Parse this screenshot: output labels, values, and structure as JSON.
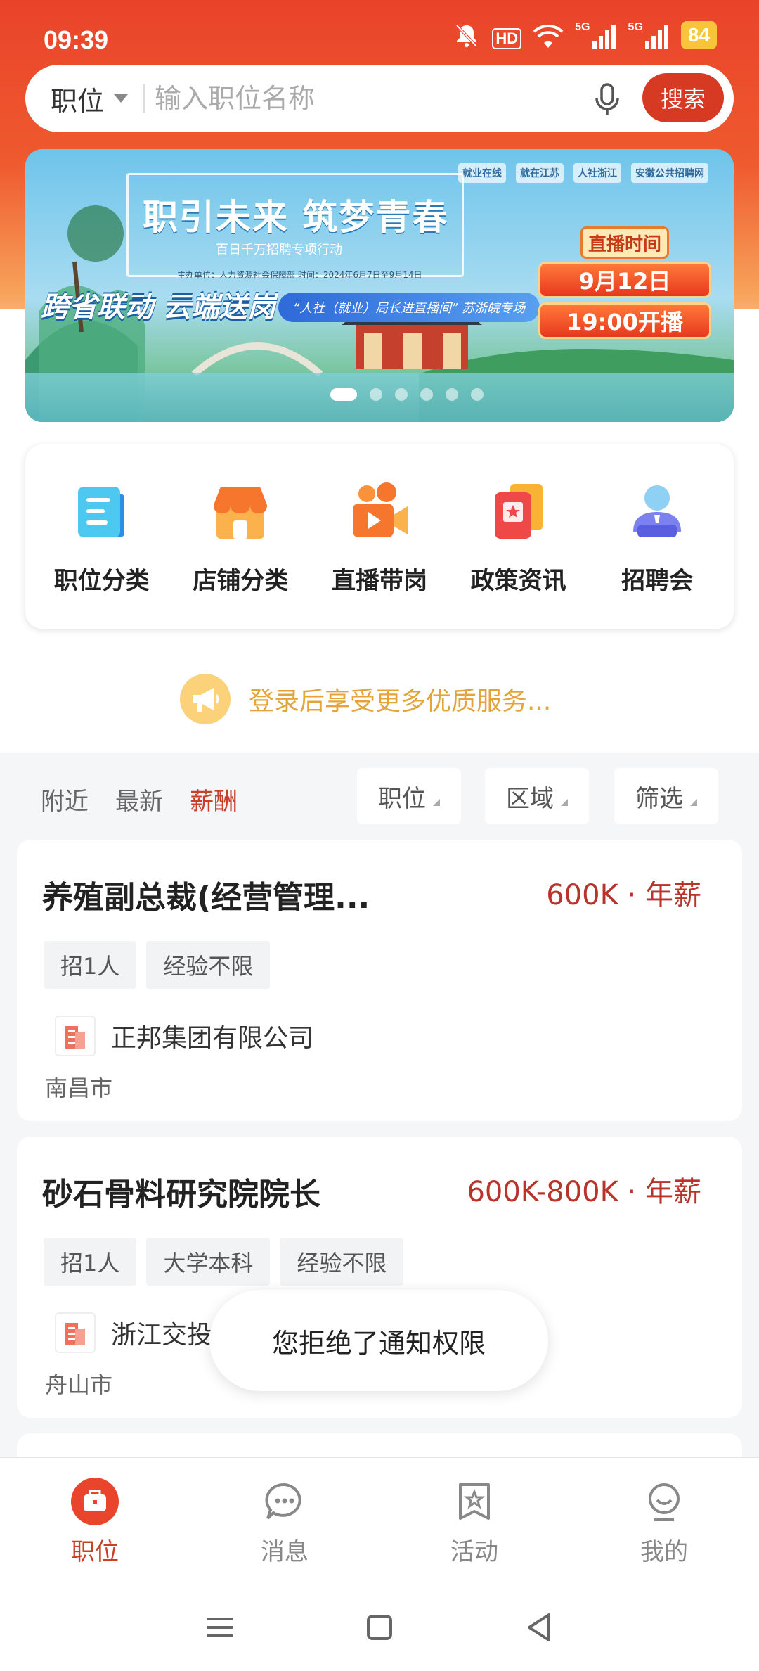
{
  "status_bar": {
    "time": "09:39",
    "hd_label": "HD",
    "signal1_label": "5G",
    "signal2_label": "5G",
    "battery": "84"
  },
  "search": {
    "category": "职位",
    "placeholder": "输入职位名称",
    "button_label": "搜索"
  },
  "banner": {
    "title": "职引未来  筑梦青春",
    "subtitle": "百日千万招聘专项行动",
    "org_line": "主办单位：人力资源社会保障部    时间：2024年6月7日至9月14日",
    "slogan": "跨省联动 云端送岗",
    "pill": "“人社（就业）局长进直播间” 苏浙皖专场",
    "live_label": "直播时间",
    "live_date": "9月12日",
    "live_hour": "19:00开播",
    "logos": [
      "就业在线",
      "就在江苏",
      "人社浙江",
      "安徽公共招聘网"
    ],
    "slide_count": 6,
    "active_slide": 1
  },
  "quick_menu": [
    {
      "label": "职位分类",
      "icon": "document-icon"
    },
    {
      "label": "店铺分类",
      "icon": "shop-icon"
    },
    {
      "label": "直播带岗",
      "icon": "video-camera-icon"
    },
    {
      "label": "政策资讯",
      "icon": "policy-icon"
    },
    {
      "label": "招聘会",
      "icon": "recruiter-icon"
    }
  ],
  "login_tip": "登录后享受更多优质服务...",
  "sort_tabs": [
    "附近",
    "最新",
    "薪酬"
  ],
  "active_sort": "薪酬",
  "filters": [
    "职位",
    "区域",
    "筛选"
  ],
  "jobs": [
    {
      "title": "养殖副总裁(经营管理...",
      "salary": "600K · 年薪",
      "tags": [
        "招1人",
        "经验不限"
      ],
      "company": "正邦集团有限公司",
      "city": "南昌市"
    },
    {
      "title": "砂石骨料研究院院长",
      "salary": "600K-800K · 年薪",
      "tags": [
        "招1人",
        "大学本科",
        "经验不限"
      ],
      "company": "浙江交投",
      "city": "舟山市"
    }
  ],
  "toast": "您拒绝了通知权限",
  "bottom_nav": [
    {
      "label": "职位",
      "icon": "briefcase-icon",
      "active": true
    },
    {
      "label": "消息",
      "icon": "message-icon",
      "active": false
    },
    {
      "label": "活动",
      "icon": "activity-icon",
      "active": false
    },
    {
      "label": "我的",
      "icon": "profile-icon",
      "active": false
    }
  ],
  "colors": {
    "brand": "#d73a23",
    "accent_red": "#c8402a",
    "salary": "#b8332a",
    "login_tip": "#e3a53a"
  }
}
